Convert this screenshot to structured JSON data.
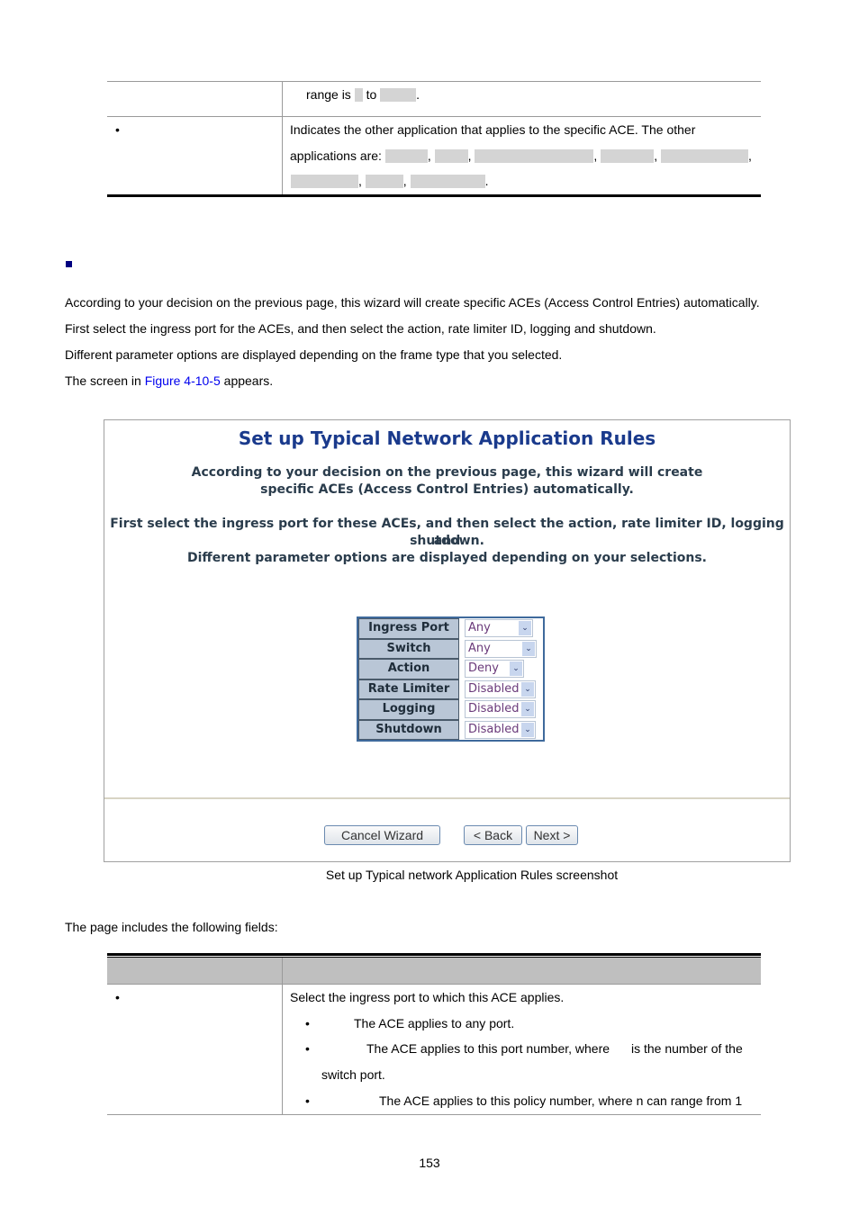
{
  "top_table": {
    "row1": {
      "range_prefix": "range is",
      "range_mid": "to",
      "range_end": "."
    },
    "row2": {
      "bullet": "•",
      "desc_line1": "Indicates the other application that applies to the specific ACE. The other",
      "desc_line2_prefix": "applications are:",
      "comma": ",",
      "period": "."
    }
  },
  "section": {
    "para1": "According to your decision on the previous page, this wizard will create specific ACEs (Access Control Entries) automatically.",
    "para2": "First select the ingress port for the ACEs, and then select the action, rate limiter ID, logging and shutdown.",
    "para3": "Different parameter options are displayed depending on the frame type that you selected.",
    "para4_prefix": "The screen in ",
    "para4_link": "Figure 4-10-5",
    "para4_suffix": " appears."
  },
  "screenshot": {
    "title": "Set up Typical Network Application Rules",
    "desc1_line1": "According to your decision on the previous page, this wizard will create",
    "desc1_line2": "specific ACEs (Access Control Entries) automatically.",
    "desc2_line1": "First select the ingress port for these ACEs, and then select the action, rate limiter ID, logging and",
    "desc2_line2": "shutdown.",
    "desc2_line3": "Different parameter options are displayed depending on your selections.",
    "params": [
      {
        "label": "Ingress Port",
        "value": "Any"
      },
      {
        "label": "Switch",
        "value": "Any"
      },
      {
        "label": "Action",
        "value": "Deny"
      },
      {
        "label": "Rate Limiter ID",
        "value": "Disabled"
      },
      {
        "label": "Logging",
        "value": "Disabled"
      },
      {
        "label": "Shutdown",
        "value": "Disabled"
      }
    ],
    "dropdown_arrow": "⌄",
    "buttons": {
      "cancel": "Cancel Wizard",
      "back": "< Back",
      "next": "Next >"
    }
  },
  "caption": "Set up Typical network Application Rules screenshot",
  "fields_intro": "The page includes the following fields:",
  "fields_table": {
    "row1": {
      "bullet": "•",
      "desc": "Select the ingress port to which this ACE applies.",
      "sub": [
        {
          "bullet": "•",
          "text": "The ACE applies to any port."
        },
        {
          "bullet": "•",
          "text": "The ACE applies to this port number, where",
          "text_b": "is the number of the",
          "cont": "switch port."
        },
        {
          "bullet": "•",
          "text": "The ACE applies to this policy number, where n can range from 1"
        }
      ]
    }
  },
  "page_number": "153"
}
